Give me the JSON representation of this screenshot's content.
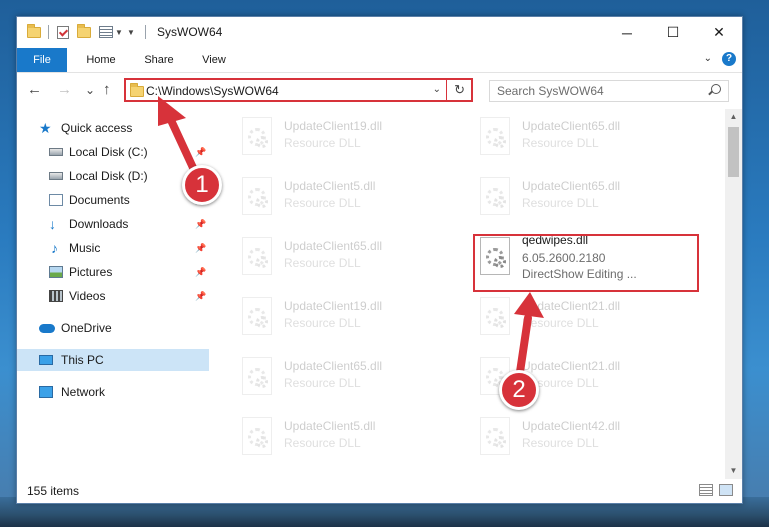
{
  "window": {
    "title": "SysWOW64",
    "controls": {
      "minimize": "─",
      "maximize": "☐",
      "close": "✕"
    }
  },
  "ribbon": {
    "tabs": [
      "File",
      "Home",
      "Share",
      "View"
    ],
    "help": "?"
  },
  "nav": {
    "back": "←",
    "forward": "→",
    "recent": "⌄",
    "up": "↑",
    "address": "C:\\Windows\\SysWOW64",
    "refresh": "↻",
    "search_placeholder": "Search SysWOW64"
  },
  "sidebar": {
    "items": [
      {
        "label": "Quick access",
        "icon": "star-icon",
        "pinned": false
      },
      {
        "label": "Local Disk (C:)",
        "icon": "drive-icon",
        "pinned": true
      },
      {
        "label": "Local Disk (D:)",
        "icon": "drive-icon",
        "pinned": false
      },
      {
        "label": "Documents",
        "icon": "documents-icon",
        "pinned": true
      },
      {
        "label": "Downloads",
        "icon": "downloads-icon",
        "pinned": true
      },
      {
        "label": "Music",
        "icon": "music-icon",
        "pinned": true
      },
      {
        "label": "Pictures",
        "icon": "pictures-icon",
        "pinned": true
      },
      {
        "label": "Videos",
        "icon": "videos-icon",
        "pinned": true
      },
      {
        "label": "OneDrive",
        "icon": "onedrive-icon",
        "pinned": false
      },
      {
        "label": "This PC",
        "icon": "this-pc-icon",
        "pinned": false,
        "selected": true
      },
      {
        "label": "Network",
        "icon": "network-icon",
        "pinned": false
      }
    ]
  },
  "files": [
    {
      "name": "UpdateClient19.dll",
      "type": "Resource DLL",
      "faded": true
    },
    {
      "name": "UpdateClient65.dll",
      "type": "Resource DLL",
      "faded": true
    },
    {
      "name": "UpdateClient5.dll",
      "type": "Resource DLL",
      "faded": true
    },
    {
      "name": "UpdateClient65.dll",
      "type": "Resource DLL",
      "faded": true
    },
    {
      "name": "UpdateClient65.dll",
      "type": "Resource DLL",
      "faded": true
    },
    {
      "name": "qedwipes.dll",
      "type": "6.05.2600.2180",
      "desc": "DirectShow Editing ...",
      "faded": false,
      "highlighted": true
    },
    {
      "name": "UpdateClient19.dll",
      "type": "Resource DLL",
      "faded": true
    },
    {
      "name": "UpdateClient21.dll",
      "type": "Resource DLL",
      "faded": true
    },
    {
      "name": "UpdateClient65.dll",
      "type": "Resource DLL",
      "faded": true
    },
    {
      "name": "UpdateClient21.dll",
      "type": "Resource DLL",
      "faded": true
    },
    {
      "name": "UpdateClient5.dll",
      "type": "Resource DLL",
      "faded": true
    },
    {
      "name": "UpdateClient42.dll",
      "type": "Resource DLL",
      "faded": true
    }
  ],
  "status": {
    "item_count": "155 items"
  },
  "annotations": {
    "step1": "1",
    "step2": "2",
    "color": "#d7323a"
  }
}
